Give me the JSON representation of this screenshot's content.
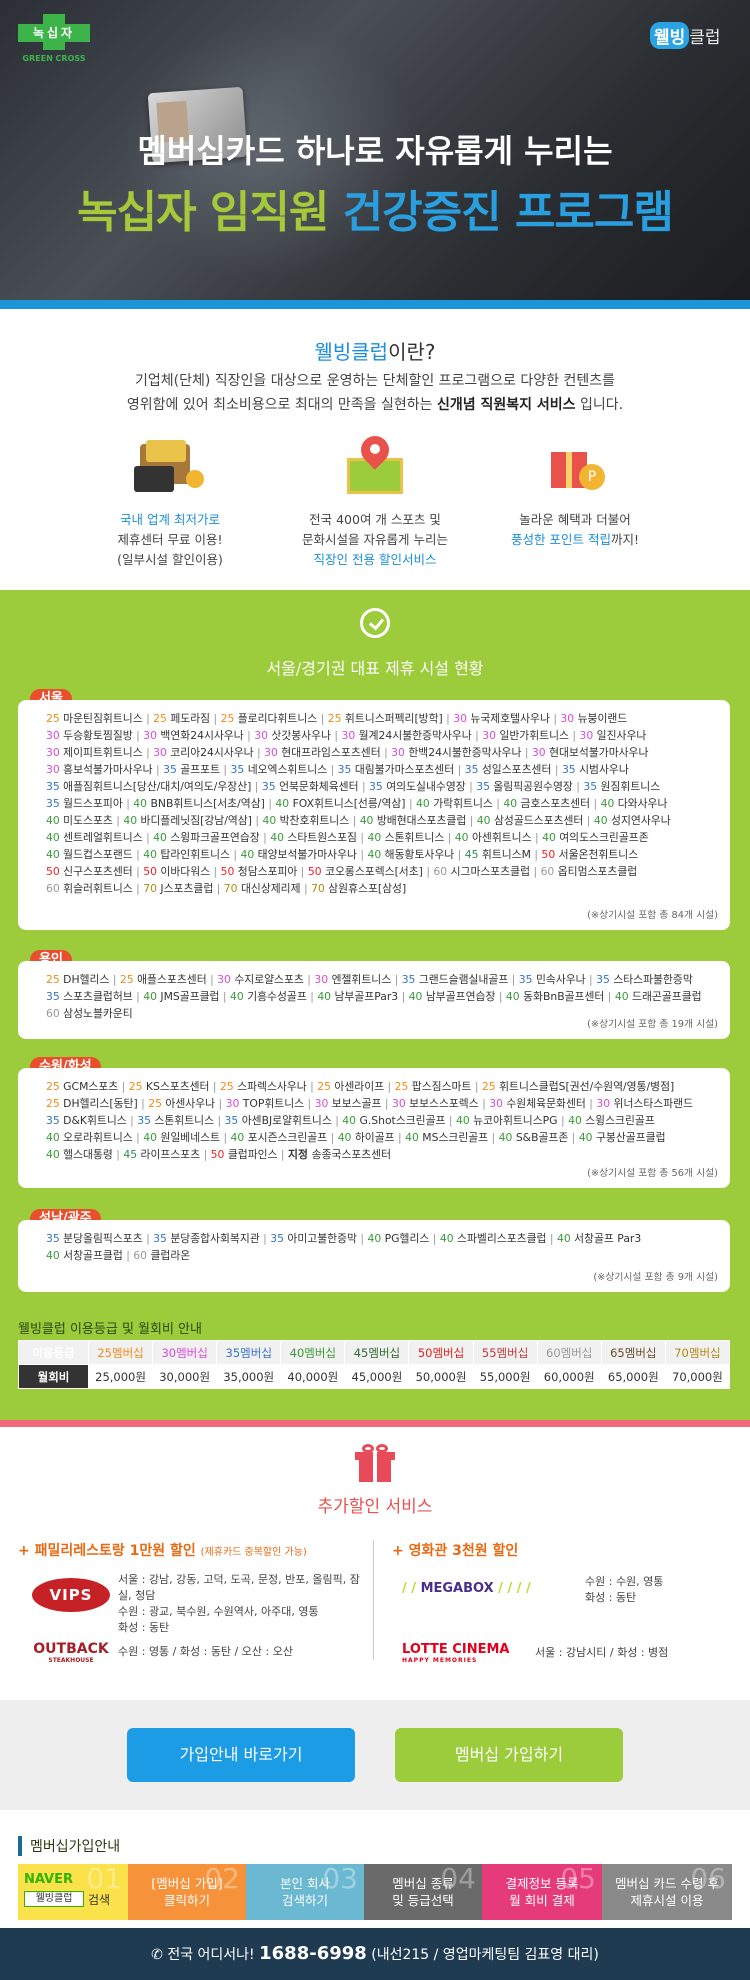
{
  "hero": {
    "logo_name": "녹십자",
    "logo_sub": "GREEN CROSS",
    "wb_logo_a": "웰빙",
    "wb_logo_b": "클럽",
    "subtitle": "멤버십카드 하나로 자유롭게 누리는",
    "title_green": "녹십자 임직원",
    "title_blue": "건강증진 프로그램"
  },
  "intro": {
    "heading_hl": "웰빙클럽",
    "heading_rest": "이란?",
    "line1": "기업체(단체) 직장인을 대상으로 운영하는 단체할인 프로그램으로 다양한 컨텐츠를",
    "line2_a": "영위함에 있어 최소비용으로 최대의 만족을 실현하는 ",
    "line2_b": "신개념 직원복지 서비스",
    "line2_c": " 입니다.",
    "features": [
      {
        "blue": "국내 업계 최저가로",
        "l2": "제휴센터 무료 이용!",
        "l3": "(일부시설 할인이용)"
      },
      {
        "l1": "전국 400여 개 스포츠 및",
        "l2": "문화시설을 자유롭게 누리는",
        "blue": "직장인 전용 할인서비스"
      },
      {
        "l1": "놀라운 혜택과 더불어",
        "blue": "풍성한 포인트 적립",
        "tail": "까지!"
      }
    ]
  },
  "facilities": {
    "title": "서울/경기권 대표 제휴 시설 현황",
    "regions": [
      {
        "name": "서울",
        "note": "(※상기시설 포함 총 84개 시설)",
        "lines": [
          "25 마운틴짐휘트니스 | 25 페도라짐 | 25 플로리다휘트니스 | 25 휘트니스퍼펙리[방학] | 30 뉴국제호텔사우나 | 30 뉴붕이랜드",
          "30 두승황토찜질방 | 30 백연화24시사우나 | 30 삿갓봉사우나 | 30 월계24시불한증막사우나 | 30 일반가휘트니스 | 30 일진사우나",
          "30 제이피트휘트니스 | 30 코리아24시사우나 | 30 현대프라임스포츠센터 | 30 한백24시불한증막사우나 | 30 현대보석불가마사우나",
          "30 홍보석불가마사우나 | 35 골프포트 | 35 네오엑스휘트니스 | 35 대림불가마스포츠센터 | 35 성일스포츠센터 | 35 시범사우나",
          "35 애플짐휘트니스[당산/대치/여의도/우장산] | 35 언북문화체육센터 | 35 여의도실내수영장 | 35 올림픽공원수영장 | 35 원짐휘트니스",
          "35 월드스포피아 | 40 BNB휘트니스[서초/역삼] | 40 FOX휘트니스[선릉/역삼] | 40 가락휘트니스 | 40 금호스포츠센터 | 40 다와사우나",
          "40 미도스포츠 | 40 바디플레닛짐[강남/역삼] | 40 박찬호휘트니스 | 40 방배현대스포츠클럽 | 40 삼성골드스포츠센터 | 40 성지연사우나",
          "40 센트레얼휘트니스 | 40 스윙파크골프연습장 | 40 스타트원스포짐 | 40 스톤휘트니스 | 40 아센휘트니스 | 40 여의도스크린골프존",
          "40 월드컵스포랜드 | 40 탑라인휘트니스 | 40 태양보석불가마사우나 | 40 해동황토사우나 | 45 휘트니스M | 50 서울온천휘트니스",
          "50 신구스포츠센터 | 50 이바다워스 | 50 청담스포피아 | 50 코오롱스포렉스[서초] | 60 시그마스포츠클럽 | 60 옵티멈스포츠클럽",
          "60 휘슬러휘트니스 | 70 J스포츠클럽 | 70 대신상제리제 | 70 삼원휴스포[삼성]"
        ]
      },
      {
        "name": "용인",
        "note": "(※상기시설 포함 총 19개 시설)",
        "lines": [
          "25 DH헬리스 | 25 애플스포츠센터 | 30 수지로얄스포츠 | 30 엔젤휘트니스 | 35 그랜드슬램실내골프 | 35 민속사우나 | 35 스타스파불한증막",
          "35 스포츠클럽허브 | 40 JMS골프클럽 | 40 기흥수성골프 | 40 남부골프Par3 | 40 남부골프연습장 | 40 동화BnB골프센터 | 40 드래곤골프클럽",
          "60 삼성노블카운티"
        ]
      },
      {
        "name": "수원/화성",
        "note": "(※상기시설 포함 총 56개 시설)",
        "lines": [
          "25 GCM스포츠 | 25 KS스포츠센터 | 25 스파렉스사우나 | 25 아센라이프 | 25 팝스짐스마트 | 25 휘트니스클럽S[권선/수원역/영통/병점]",
          "25 DH헬리스[동탄] | 25 아센사우나 | 30 TOP휘트니스 | 30 보보스골프 | 30 보보스스포렉스 | 30 수원체육문화센터 | 30 위너스타스파랜드",
          "35 D&K휘트니스 | 35 스톤휘트니스 | 35 아센BJ로얄휘트니스 | 40 G.Shot스크린골프 | 40 뉴코아휘트니스PG | 40 스윙스크린골프",
          "40 오로라휘트니스 | 40 원일베네스트 | 40 포시즌스크린골프 | 40 하이골프 | 40 MS스크린골프 | 40 S&B골프존 | 40 구봉산골프클럽",
          "40 헬스대통령 | 45 라이프스포츠 | 50 클럽파인스 | 지정 송종국스포츠센터"
        ]
      },
      {
        "name": "성남/광주",
        "note": "(※상기시설 포함 총 9개 시설)",
        "lines": [
          "35 분당올림픽스포츠 | 35 분당종합사회복지관 | 35 아미고불한증막 | 40 PG헬리스 | 40 스파벨리스포츠클럽 | 40 서창골프 Par3",
          "40 서창골프클럽 | 60 클럽라온"
        ]
      }
    ]
  },
  "fee": {
    "caption": "웰빙클럽 이용등급 및 월회비 안내",
    "grade_label": "이용등급",
    "fee_label": "월회비",
    "grades": [
      "25멤버십",
      "30멤버십",
      "35멤버십",
      "40멤버십",
      "45멤버십",
      "50멤버십",
      "55멤버십",
      "60멤버십",
      "65멤버십",
      "70멤버십"
    ],
    "grade_colors": [
      "#f08a1b",
      "#d84bd8",
      "#3573c7",
      "#3a9a3a",
      "#2e6b2e",
      "#e22222",
      "#c0393b",
      "#999999",
      "#6a4b2a",
      "#b08a10"
    ],
    "fees": [
      "25,000원",
      "30,000원",
      "35,000원",
      "40,000원",
      "45,000원",
      "50,000원",
      "55,000원",
      "60,000원",
      "65,000원",
      "70,000원"
    ]
  },
  "extra": {
    "title": "추가할인 서비스",
    "left_head": "+ 패밀리레스토랑 1만원 할인",
    "left_note": "(제휴카드 중복할인 가능)",
    "right_head": "+ 영화관 3천원 할인",
    "vips_logo": "VIPS",
    "vips_l1": "서울 : 강남, 강동, 고덕, 도곡, 문정, 반포, 올림픽, 잠실, 청담",
    "vips_l2": "수원 : 광교, 북수원, 수원역사, 아주대, 영통",
    "vips_l3": "화성 : 동탄",
    "outback_logo": "OUTBACK",
    "outback_sub": "STEAKHOUSE",
    "outback_txt": "수원 : 영통 / 화성 : 동탄 / 오산 : 오산",
    "megabox_logo": "MEGABOX",
    "megabox_l1": "수원 : 수원, 영통",
    "megabox_l2": "화성 : 동탄",
    "lotte_logo": "LOTTE CINEMA",
    "lotte_sub": "HAPPY MEMORIES",
    "lotte_txt": "서울 : 강남시티 / 화성 : 병점"
  },
  "cta": {
    "join_guide": "가입안내 바로가기",
    "join_member": "멤버십 가입하기"
  },
  "steps": {
    "title": "멤버십가입안내",
    "items": [
      {
        "num": "01",
        "l1": "NAVER",
        "l2": "웰빙클럽",
        "l3": "검색"
      },
      {
        "num": "02",
        "l1": "[멤버십 가입]",
        "l2": "클릭하기"
      },
      {
        "num": "03",
        "l1": "본인 회사",
        "l2": "검색하기"
      },
      {
        "num": "04",
        "l1": "멤버십 종류",
        "l2": "및 등급선택"
      },
      {
        "num": "05",
        "l1": "결제정보 등록",
        "l2": "월 회비 결제"
      },
      {
        "num": "06",
        "l1": "멤버십 카드 수령 후",
        "l2": "제휴시설 이용"
      }
    ]
  },
  "footer": {
    "lead": "전국 어디서나!",
    "phone": "1688-6998",
    "tail": "(내선215 / 영업마케팅팀 김표영 대리)"
  }
}
